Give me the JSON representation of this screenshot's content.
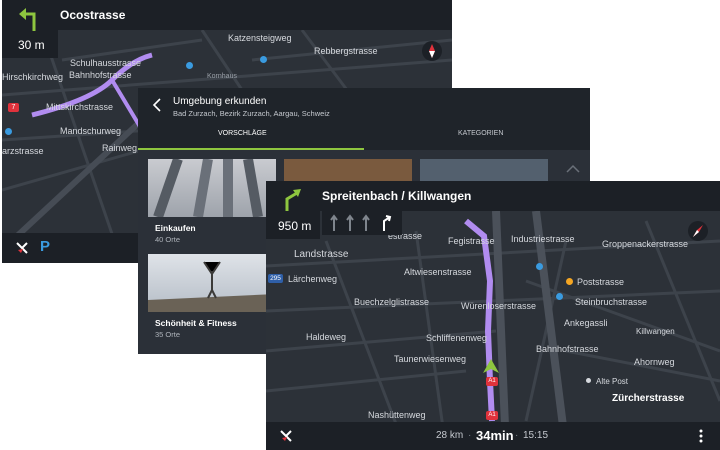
{
  "screen1": {
    "street_name": "Ocostrasse",
    "distance": "30 m",
    "streets": [
      "Katzensteigweg",
      "Rebbergstrasse",
      "Bahnhofstrasse",
      "Schulhausstrasse",
      "Mittelgstrasse",
      "Mittskirchstrasse",
      "Mandschurweg",
      "Rainweg",
      "arzstrasse",
      "Hirschkirchweg",
      "Kornhaus"
    ],
    "route_badge": "7",
    "parking_label": "P"
  },
  "screen2": {
    "title": "Umgebung erkunden",
    "subtitle": "Bad Zurzach, Bezirk Zurzach, Aargau, Schweiz",
    "tabs": {
      "suggestions": "VORSCHLÄGE",
      "categories": "KATEGORIEN"
    },
    "cards": [
      {
        "title": "Einkaufen",
        "count": "40 Orte"
      },
      {
        "title": "Schönheit & Fitness",
        "count": "35 Orte"
      }
    ]
  },
  "screen3": {
    "destination": "Spreitenbach / Killwangen",
    "distance": "950 m",
    "streets": {
      "landstrasse": "Landstrasse",
      "laerchenweg": "Lärchenweg",
      "buechzelgli": "Buechzelglistrasse",
      "haldeweg": "Haldeweg",
      "taunerwiesen": "Taunerwiesenweg",
      "nashuetten": "Nashüttenweg",
      "schiffenenweg": "Schliffenenweg",
      "altwiesen": "Altwiesenstrasse",
      "wuerenloser": "Würenloserstrasse",
      "fegistrasse": "Fegistrasse",
      "industrie": "Industriestrasse",
      "groppenacker": "Groppenackerstrasse",
      "poststrasse": "Poststrasse",
      "steinbruch": "Steinbruchstrasse",
      "ankegassli": "Ankegassli",
      "killwangen": "Killwangen",
      "bahnhof": "Bahnhofstrasse",
      "ahornweg": "Ahornweg",
      "altepost": "Alte Post",
      "zuercher": "Zürcherstrasse",
      "estrasse": "estrasse"
    },
    "badges": {
      "road295": "295",
      "a1": "A1",
      "a1b": "A1"
    },
    "trip": {
      "distance": "28 km",
      "duration": "34min",
      "arrival": "15:15"
    }
  },
  "colors": {
    "route": "#b18cf0",
    "accent": "#8ec63f",
    "poi_blue": "#3a9be0",
    "poi_orange": "#f5a623",
    "badge_red": "#e0323c"
  }
}
